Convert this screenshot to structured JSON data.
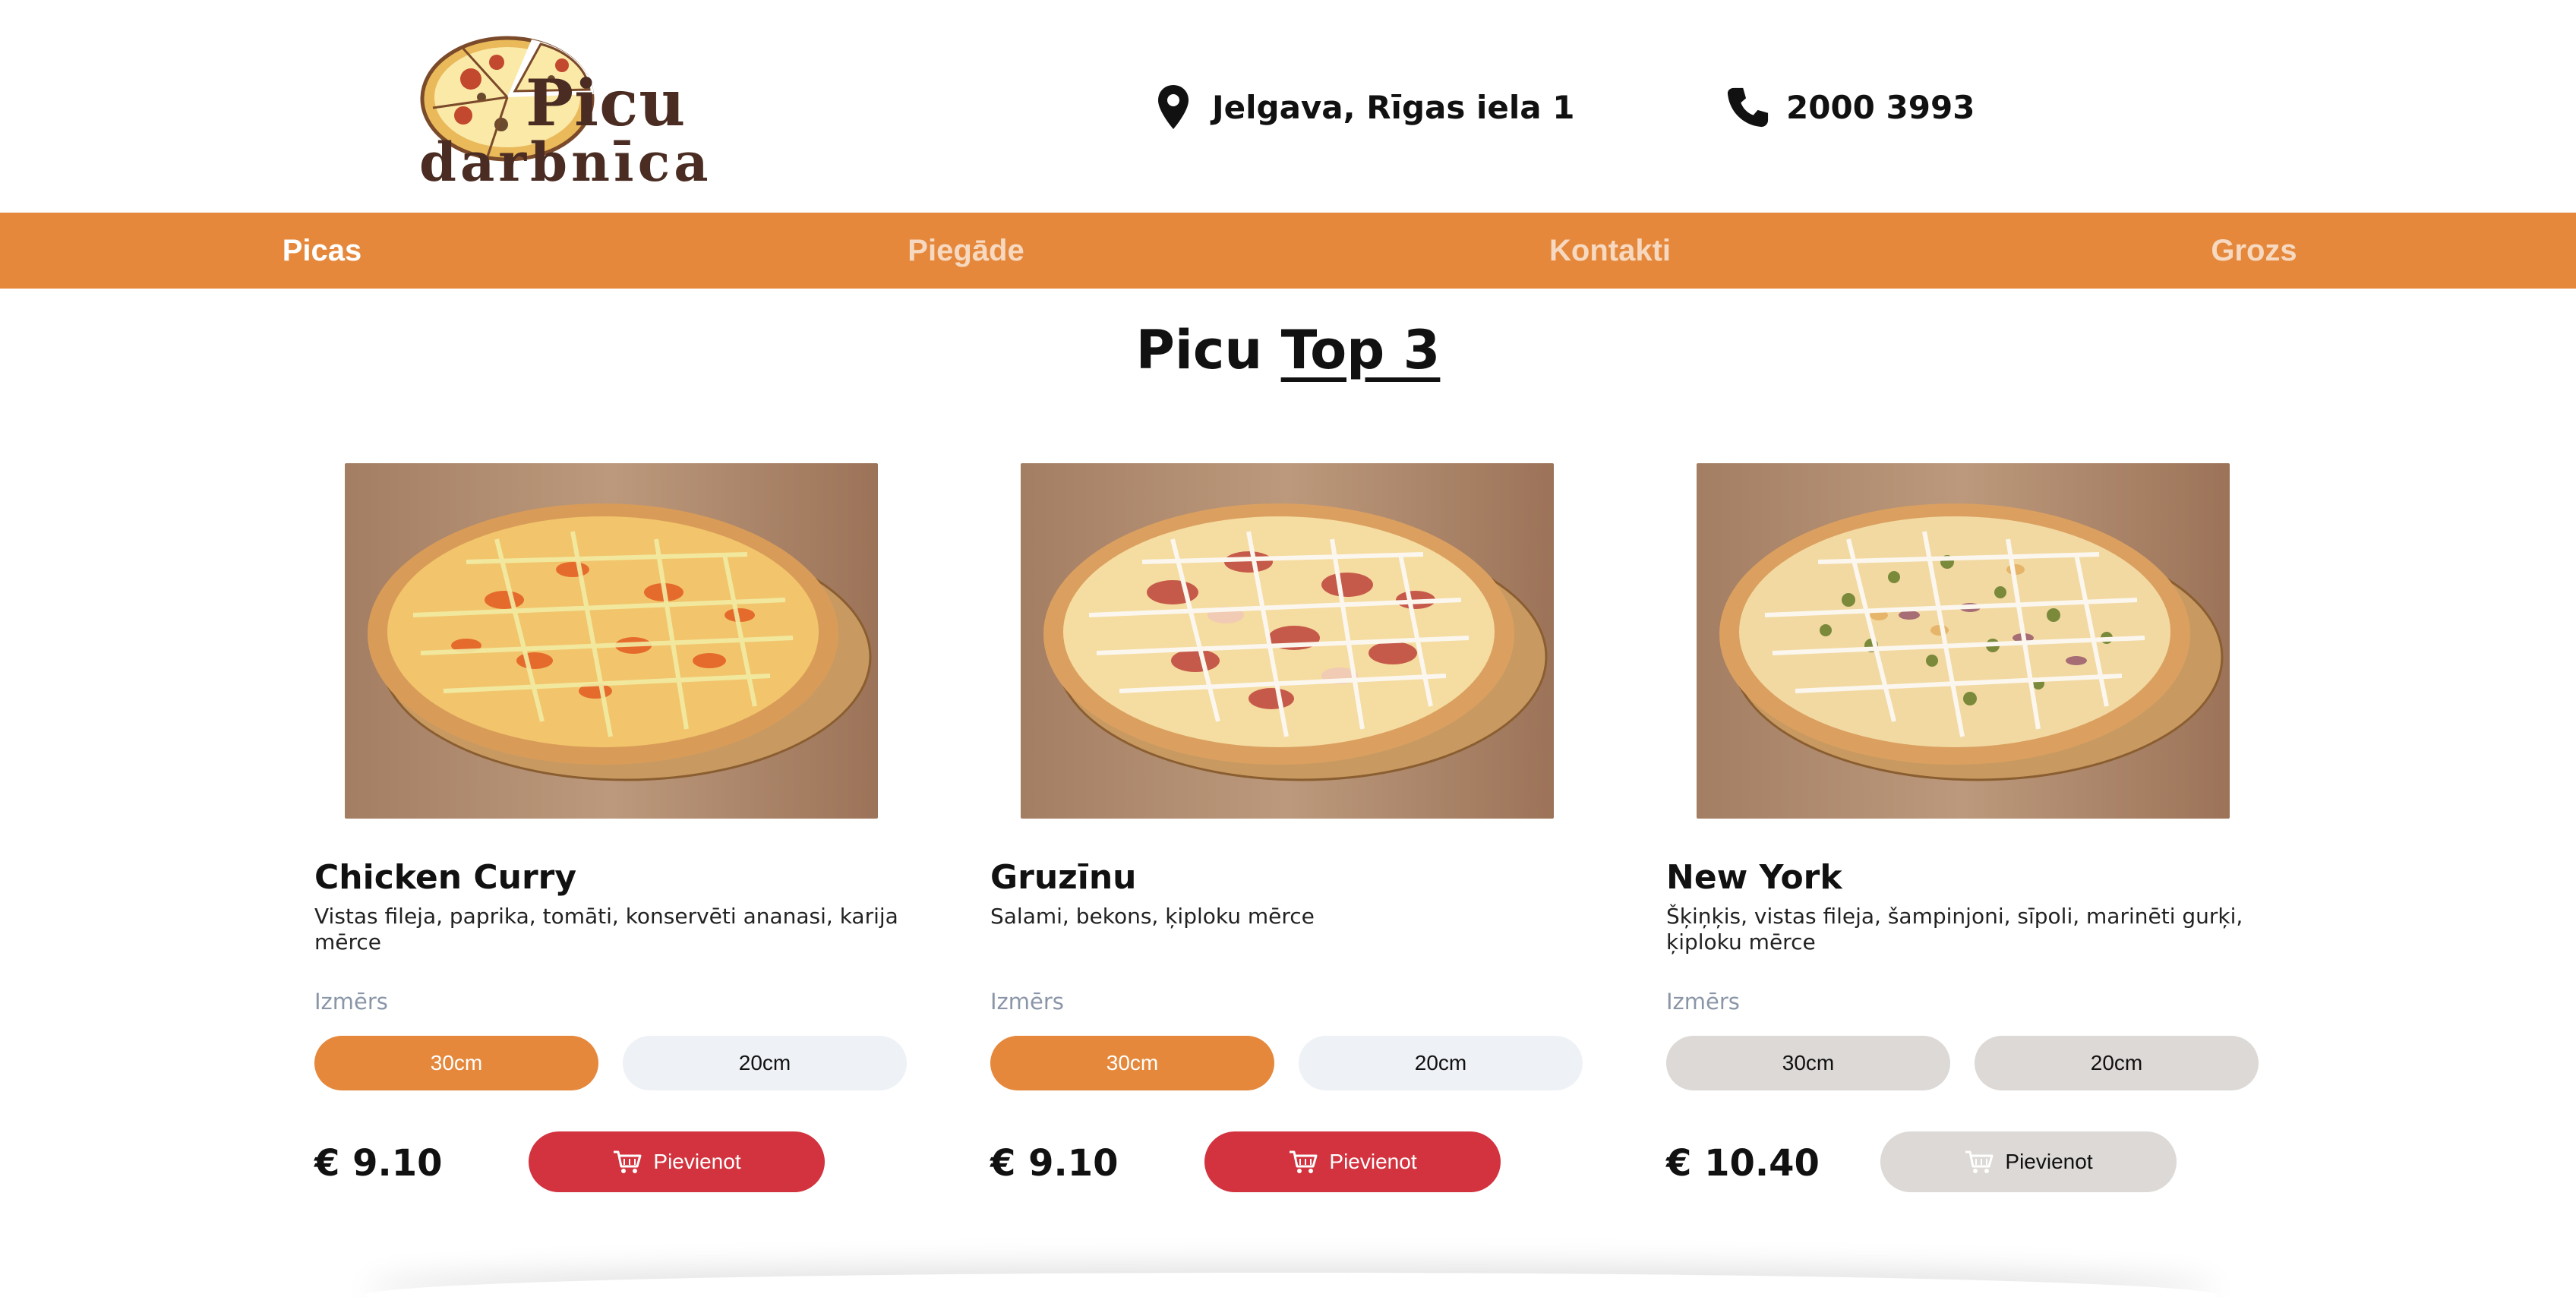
{
  "brand": {
    "logo_line1": "Picu",
    "logo_line2": "darbnīca"
  },
  "contact": {
    "address": "Jelgava, Rīgas iela 1",
    "phone": "2000 3993",
    "location_icon": "map-pin-icon",
    "phone_icon": "phone-icon"
  },
  "nav": {
    "items": [
      {
        "label": "Picas",
        "active": true
      },
      {
        "label": "Piegāde",
        "active": false
      },
      {
        "label": "Kontakti",
        "active": false
      },
      {
        "label": "Grozs",
        "active": false
      }
    ]
  },
  "section": {
    "title_prefix": "Picu",
    "title_highlight": "Top 3"
  },
  "products": [
    {
      "name": "Chicken Curry",
      "description": "Vistas fileja, paprika, tomāti, konservēti ananasi, karija mērce",
      "size_label": "Izmērs",
      "sizes": [
        "30cm",
        "20cm"
      ],
      "selected_size": "30cm",
      "price": "€ 9.10",
      "add_label": "Pievienot",
      "available": true
    },
    {
      "name": "Gruzīnu",
      "description": "Salami, bekons, ķiploku mērce",
      "size_label": "Izmērs",
      "sizes": [
        "30cm",
        "20cm"
      ],
      "selected_size": "30cm",
      "price": "€ 9.10",
      "add_label": "Pievienot",
      "available": true
    },
    {
      "name": "New York",
      "description": "Šķiņķis, vistas fileja, šampinjoni, sīpoli, marinēti gurķi, ķiploku mērce",
      "size_label": "Izmērs",
      "sizes": [
        "30cm",
        "20cm"
      ],
      "selected_size": "",
      "price": "€ 10.40",
      "add_label": "Pievienot",
      "available": false
    }
  ],
  "colors": {
    "accent": "#e5883b",
    "add_button": "#d2333e",
    "disabled": "#dcd9d6"
  }
}
